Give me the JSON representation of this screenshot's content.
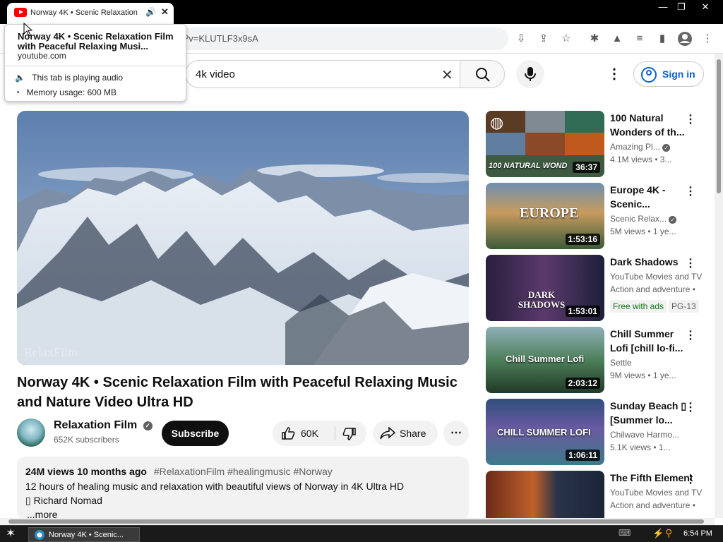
{
  "browser": {
    "tab_title": "Norway 4K • Scenic Relaxation",
    "url_fragment": "?v=KLUTLF3x9sA",
    "tooltip": {
      "title": "Norway 4K • Scenic Relaxation Film with Peaceful Relaxing Musi...",
      "domain": "youtube.com",
      "audio_status": "This tab is playing audio",
      "memory": "Memory usage: 600 MB"
    }
  },
  "youtube": {
    "search_value": "4k video",
    "sign_in": "Sign in"
  },
  "video": {
    "title": "Norway 4K • Scenic Relaxation Film with Peaceful Relaxing Music and Nature Video Ultra HD",
    "channel": "Relaxation Film",
    "subscribers": "652K subscribers",
    "subscribe_label": "Subscribe",
    "likes": "60K",
    "share_label": "Share",
    "watermark": "RelaxFilm",
    "description": {
      "stats": "24M views  10 months ago",
      "tags": "#RelaxationFilm #healingmusic #Norway",
      "line2": "12 hours of healing music and relaxation with beautiful views of Norway in 4K Ultra HD",
      "line3": "▯ Richard Nomad",
      "more": "...more"
    }
  },
  "recommendations": [
    {
      "title": "100 Natural Wonders of th...",
      "channel": "Amazing Pl...",
      "meta": "4.1M views  • 3...",
      "duration": "36:37",
      "thumb_text": "100 NATURAL WOND"
    },
    {
      "title": "Europe 4K - Scenic...",
      "channel": "Scenic Relax...",
      "meta": "5M views  • 1 ye...",
      "duration": "1:53:16",
      "thumb_text": "EUROPE"
    },
    {
      "title": "Dark Shadows",
      "channel": "YouTube Movies and TV",
      "meta": "Action and adventure •",
      "duration": "1:53:01",
      "thumb_text": "DARK SHADOWS",
      "badge1": "Free with ads",
      "badge2": "PG-13"
    },
    {
      "title": "Chill Summer Lofi [chill lo-fi...",
      "channel": "Settle",
      "meta": "9M views  • 1 ye...",
      "duration": "2:03:12",
      "thumb_text": "Chill Summer Lofi"
    },
    {
      "title": "Sunday Beach ▯ [Summer lo...",
      "channel": "Chilwave Harmo...",
      "meta": "5.1K views  • 1...",
      "duration": "1:06:11",
      "thumb_text": "CHILL SUMMER LOFI"
    },
    {
      "title": "The Fifth Element",
      "channel": "YouTube Movies and TV",
      "meta": "Action and adventure •",
      "duration": "",
      "thumb_text": ""
    }
  ],
  "taskbar": {
    "item_label": "Norway 4K • Scenic...",
    "clock": "6:54 PM"
  },
  "colors": {
    "accent_blue": "#065fd4",
    "youtube_red": "#ff0000",
    "free_with_ads": "#107516"
  }
}
